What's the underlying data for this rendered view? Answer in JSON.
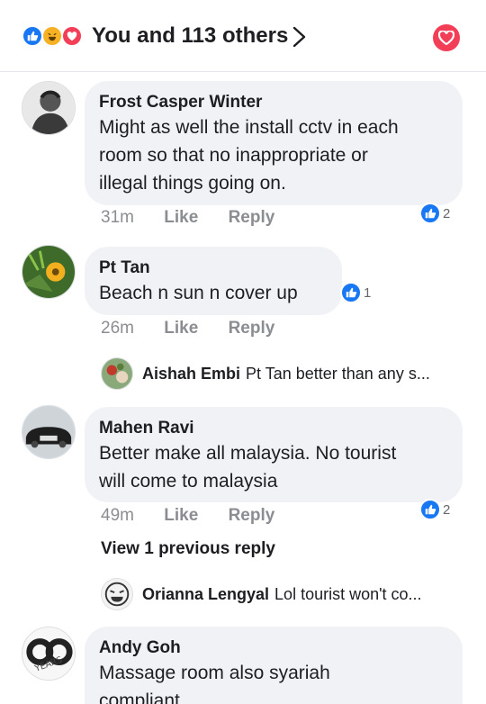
{
  "header": {
    "reaction_icons": [
      "like-icon",
      "haha-icon",
      "love-icon"
    ],
    "summary": "You and 113 others",
    "chevron": "chevron-right-icon",
    "love_button_icon": "heart-icon"
  },
  "comments": [
    {
      "author": "Frost Casper Winter",
      "text_lines": [
        "Might as well the install cctv in each",
        "room so that no inappropriate or",
        "illegal things going on."
      ],
      "time": "31m",
      "like_label": "Like",
      "reply_label": "Reply",
      "reaction_count": "2"
    },
    {
      "author": "Pt Tan",
      "text_lines": [
        "Beach n sun n cover up"
      ],
      "time": "26m",
      "like_label": "Like",
      "reply_label": "Reply",
      "reaction_count": "1",
      "reply_preview": {
        "name": "Aishah Embi",
        "text": "Pt Tan better than any s..."
      }
    },
    {
      "author": "Mahen Ravi",
      "text_lines": [
        "Better make all malaysia. No tourist",
        "will come to malaysia"
      ],
      "time": "49m",
      "like_label": "Like",
      "reply_label": "Reply",
      "reaction_count": "2",
      "view_previous": "View 1 previous reply",
      "reply_preview": {
        "name": "Orianna Lengyal",
        "text": "Lol tourist won't co..."
      }
    },
    {
      "author": "Andy Goh",
      "text_lines": [
        "Massage room also syariah",
        "compliant"
      ],
      "avatar_text": "YEARS"
    }
  ],
  "colors": {
    "like_blue": "#1877f2",
    "love_red": "#f33e58",
    "haha_yellow": "#f7b125",
    "bubble_gray": "#f0f2f5",
    "meta_gray": "#8a8d91"
  }
}
